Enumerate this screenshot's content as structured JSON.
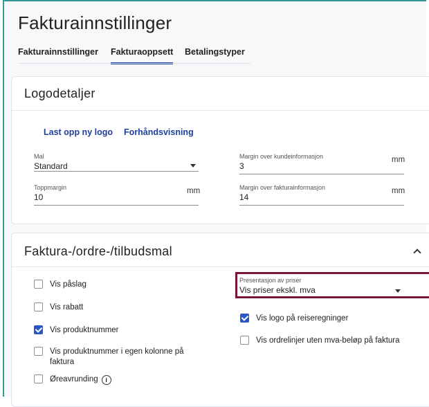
{
  "page": {
    "title": "Fakturainnstillinger"
  },
  "tabs": [
    {
      "label": "Fakturainnstillinger",
      "active": false
    },
    {
      "label": "Fakturaoppsett",
      "active": true
    },
    {
      "label": "Betalingstyper",
      "active": false
    }
  ],
  "logo_section": {
    "title": "Logodetaljer",
    "upload_link": "Last opp ny logo",
    "preview_link": "Forhåndsvisning",
    "template": {
      "label": "Mal",
      "value": "Standard"
    },
    "top_margin": {
      "label": "Toppmargin",
      "value": "10",
      "unit": "mm"
    },
    "margin_customer": {
      "label": "Margin over kundeinformasjon",
      "value": "3",
      "unit": "mm"
    },
    "margin_invoice": {
      "label": "Margin over fakturainformasjon",
      "value": "14",
      "unit": "mm"
    }
  },
  "template_section": {
    "title": "Faktura-/ordre-/tilbudsmal",
    "checkboxes_left": [
      {
        "label": "Vis påslag",
        "checked": false
      },
      {
        "label": "Vis rabatt",
        "checked": false
      },
      {
        "label": "Vis produktnummer",
        "checked": true
      },
      {
        "label": "Vis produktnummer i egen kolonne på faktura",
        "checked": false
      },
      {
        "label": "Øreavrunding",
        "checked": false,
        "info_icon": "info-icon"
      }
    ],
    "price_presentation": {
      "label": "Presentasjon av priser",
      "value": "Vis priser ekskl. mva"
    },
    "checkboxes_right": [
      {
        "label": "Vis logo på reiseregninger",
        "checked": true
      },
      {
        "label": "Vis ordrelinjer uten mva-beløp på faktura",
        "checked": false
      }
    ]
  },
  "colors": {
    "accent": "#1f3f9d",
    "checkbox": "#2a56c6",
    "highlight": "#7a1535",
    "frame": "#2f9c98"
  }
}
